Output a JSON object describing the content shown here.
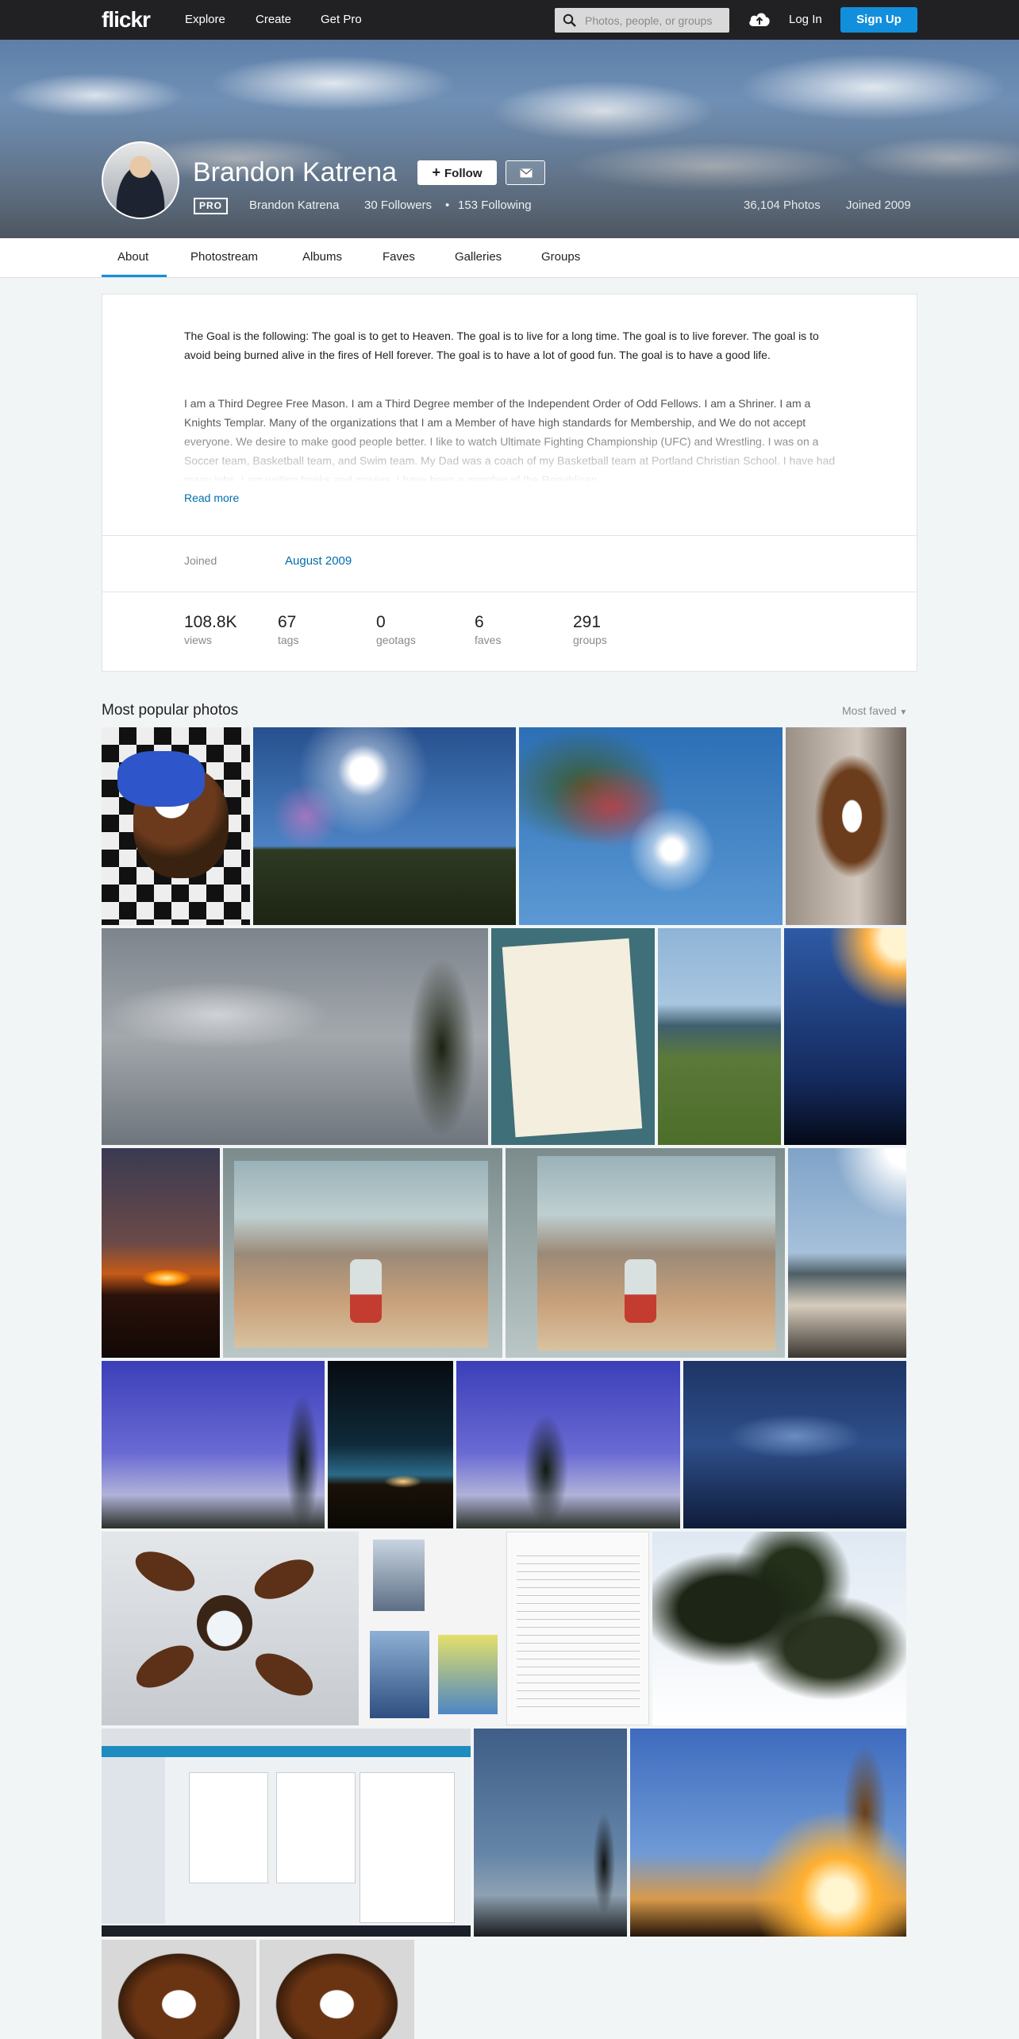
{
  "nav": {
    "logo": "flickr",
    "links": [
      "Explore",
      "Create",
      "Get Pro"
    ],
    "search_placeholder": "Photos, people, or groups",
    "login": "Log In",
    "signup": "Sign Up"
  },
  "profile": {
    "name": "Brandon Katrena",
    "follow_label": "Follow",
    "pro_badge": "PRO",
    "display_name": "Brandon Katrena",
    "followers": "30 Followers",
    "separator": "•",
    "following": "153 Following",
    "photos": "36,104 Photos",
    "joined": "Joined 2009"
  },
  "tabs": [
    "About",
    "Photostream",
    "Albums",
    "Faves",
    "Galleries",
    "Groups"
  ],
  "about": {
    "bio_1": "The Goal is the following: The goal is to get to Heaven. The goal is to live for a long time. The goal is to live forever. The goal is to avoid being burned alive in the fires of Hell forever. The goal is to have a lot of good fun. The goal is to have a good life.",
    "bio_2": "I am a Third Degree Free Mason. I am a Third Degree member of the Independent Order of Odd Fellows. I am a Shriner. I am a Knights Templar. Many of the organizations that I am a Member of have high standards for Membership, and We do not accept everyone. We desire to make good people better. I like to watch Ultimate Fighting Championship (UFC) and Wrestling. I was on a Soccer team, Basketball team, and Swim team. My Dad was a coach of my Basketball team at Portland Christian School. I have had many jobs. I am writing books and movies. I have been a member of the Republican",
    "read_more": "Read more",
    "joined_label": "Joined",
    "joined_value": "August 2009",
    "stats": [
      {
        "value": "108.8K",
        "label": "views"
      },
      {
        "value": "67",
        "label": "tags"
      },
      {
        "value": "0",
        "label": "geotags"
      },
      {
        "value": "6",
        "label": "faves"
      },
      {
        "value": "291",
        "label": "groups"
      }
    ]
  },
  "popular": {
    "title": "Most popular photos",
    "sort": "Most faved"
  }
}
